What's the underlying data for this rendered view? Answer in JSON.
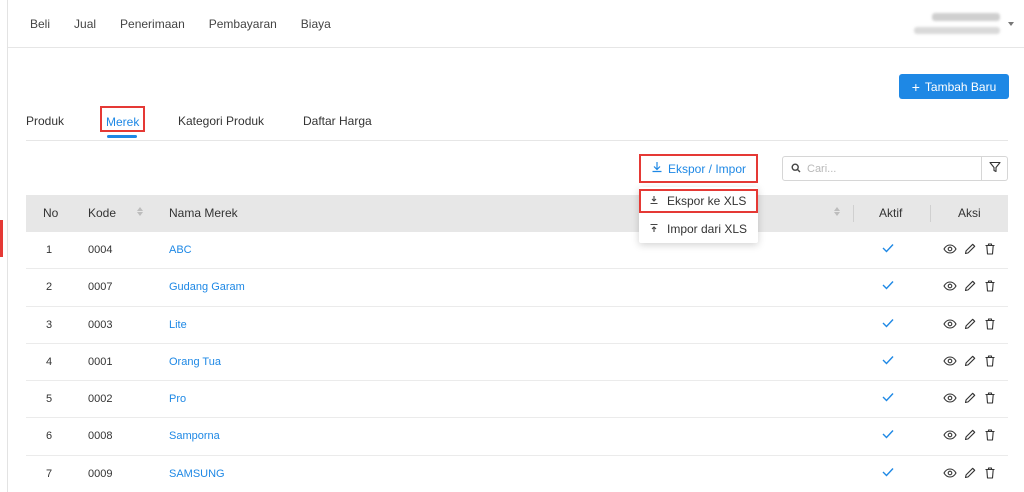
{
  "topnav": {
    "items": [
      "Beli",
      "Jual",
      "Penerimaan",
      "Pembayaran",
      "Biaya"
    ]
  },
  "actions": {
    "add_label": "Tambah Baru",
    "export_label": "Ekspor / Impor"
  },
  "tabs": [
    "Produk",
    "Merek",
    "Kategori Produk",
    "Daftar Harga"
  ],
  "active_tab": "Merek",
  "search": {
    "placeholder": "Cari..."
  },
  "dropdown": {
    "items": [
      "Ekspor ke XLS",
      "Impor dari XLS"
    ]
  },
  "table": {
    "headers": {
      "no": "No",
      "kode": "Kode",
      "nama": "Nama Merek",
      "aktif": "Aktif",
      "aksi": "Aksi"
    },
    "rows": [
      {
        "no": "1",
        "kode": "0004",
        "nama": "ABC"
      },
      {
        "no": "2",
        "kode": "0007",
        "nama": "Gudang Garam"
      },
      {
        "no": "3",
        "kode": "0003",
        "nama": "Lite"
      },
      {
        "no": "4",
        "kode": "0001",
        "nama": "Orang Tua"
      },
      {
        "no": "5",
        "kode": "0002",
        "nama": "Pro"
      },
      {
        "no": "6",
        "kode": "0008",
        "nama": "Samporna"
      },
      {
        "no": "7",
        "kode": "0009",
        "nama": "SAMSUNG"
      }
    ]
  },
  "colors": {
    "accent": "#1e88e5",
    "highlight": "#e53935",
    "header_bg": "#e7e7e7"
  }
}
